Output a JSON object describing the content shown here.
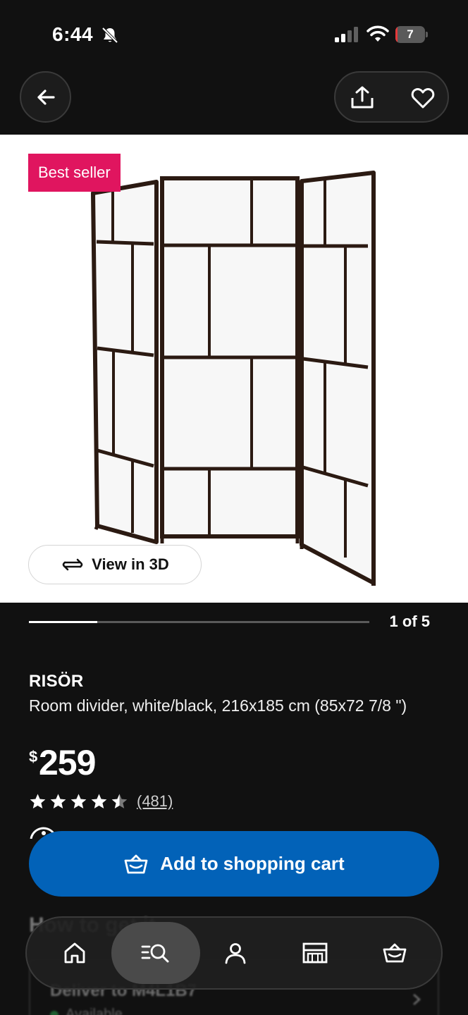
{
  "status_bar": {
    "time": "6:44",
    "battery_level": "7",
    "icons": [
      "bell-slash-icon",
      "signal-icon",
      "wifi-icon",
      "battery-icon"
    ],
    "battery_color": "#e5393a"
  },
  "nav": {
    "back_icon": "arrow-left-icon",
    "share_icon": "share-icon",
    "favorite_icon": "heart-icon"
  },
  "product_image": {
    "badge": "Best seller",
    "badge_color": "#e0155f",
    "view_3d_label": "View in 3D",
    "view_3d_icon": "rotate-3d-icon"
  },
  "carousel": {
    "counter": "1 of 5",
    "current": 1,
    "total": 5
  },
  "product": {
    "name": "RISÖR",
    "description": "Room divider, white/black, 216x185 cm (85x72 7/8 \")",
    "price_currency": "$",
    "price": "259",
    "rating": 4.5,
    "rating_max": 5,
    "review_count": "(481)"
  },
  "cart": {
    "label": "Add to shopping cart",
    "icon": "basket-icon",
    "color": "#0262b8"
  },
  "behind_nav": {
    "heading": "How to get it",
    "deliver_label": "Deliver to M4L1B7",
    "availability": "Available"
  },
  "bottom_nav": {
    "items": [
      {
        "icon": "home-icon",
        "active": false
      },
      {
        "icon": "search-list-icon",
        "active": true
      },
      {
        "icon": "profile-icon",
        "active": false
      },
      {
        "icon": "store-icon",
        "active": false
      },
      {
        "icon": "basket-icon",
        "active": false
      }
    ]
  }
}
